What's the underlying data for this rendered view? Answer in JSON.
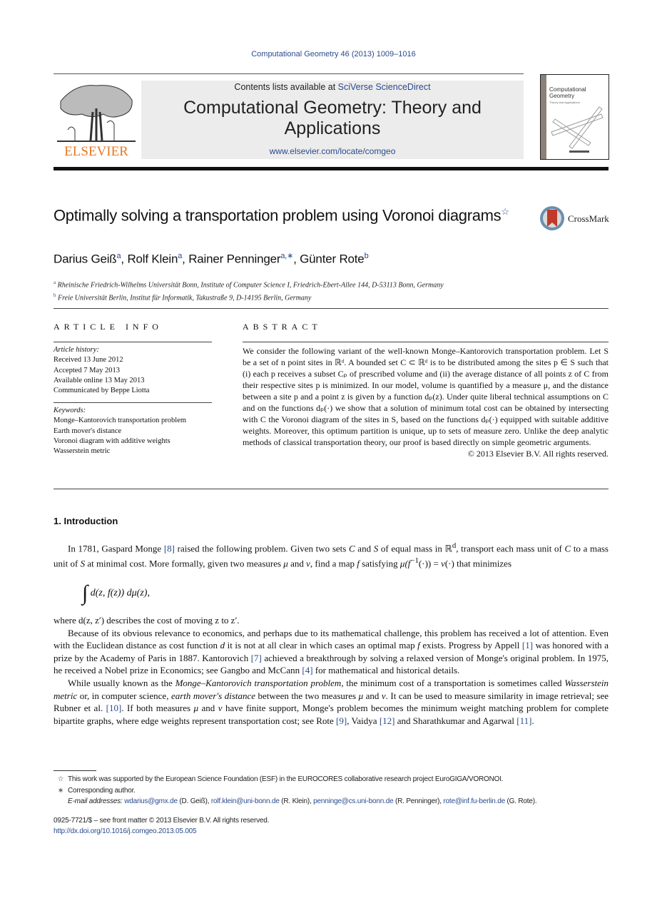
{
  "header": {
    "journal_ref": "Computational Geometry 46 (2013) 1009–1016",
    "publisher_logo_text": "ELSEVIER",
    "contents_prefix": "Contents lists available at ",
    "contents_link": "SciVerse ScienceDirect",
    "journal_title": "Computational Geometry: Theory and Applications",
    "journal_url": "www.elsevier.com/locate/comgeo",
    "cover_title": "Computational Geometry",
    "cover_subtitle": "Theory and Applications"
  },
  "article": {
    "title": "Optimally solving a transportation problem using Voronoi diagrams",
    "title_note_mark": "☆",
    "crossmark_label": "CrossMark",
    "authors": [
      {
        "name": "Darius Geiß",
        "sup": "a"
      },
      {
        "name": "Rolf Klein",
        "sup": "a"
      },
      {
        "name": "Rainer Penninger",
        "sup": "a,∗"
      },
      {
        "name": "Günter Rote",
        "sup": "b"
      }
    ],
    "affiliations": [
      {
        "mark": "a",
        "text": "Rheinische Friedrich-Wilhelms Universität Bonn, Institute of Computer Science I, Friedrich-Ebert-Allee 144, D-53113 Bonn, Germany"
      },
      {
        "mark": "b",
        "text": "Freie Universität Berlin, Institut für Informatik, Takustraße 9, D-14195 Berlin, Germany"
      }
    ]
  },
  "article_info": {
    "heading": "ARTICLE INFO",
    "history_label": "Article history:",
    "history": [
      "Received 13 June 2012",
      "Accepted 7 May 2013",
      "Available online 13 May 2013",
      "Communicated by Beppe Liotta"
    ],
    "keywords_label": "Keywords:",
    "keywords": [
      "Monge–Kantorovich transportation problem",
      "Earth mover's distance",
      "Voronoi diagram with additive weights",
      "Wasserstein metric"
    ]
  },
  "abstract": {
    "heading": "ABSTRACT",
    "text": "We consider the following variant of the well-known Monge–Kantorovich transportation problem. Let S be a set of n point sites in ℝᵈ. A bounded set C ⊂ ℝᵈ is to be distributed among the sites p ∈ S such that (i) each p receives a subset Cₚ of prescribed volume and (ii) the average distance of all points z of C from their respective sites p is minimized. In our model, volume is quantified by a measure μ, and the distance between a site p and a point z is given by a function dₚ(z). Under quite liberal technical assumptions on C and on the functions dₚ(·) we show that a solution of minimum total cost can be obtained by intersecting with C the Voronoi diagram of the sites in S, based on the functions dₚ(·) equipped with suitable additive weights. Moreover, this optimum partition is unique, up to sets of measure zero. Unlike the deep analytic methods of classical transportation theory, our proof is based directly on simple geometric arguments.",
    "copyright": "© 2013 Elsevier B.V. All rights reserved."
  },
  "introduction": {
    "heading": "1. Introduction",
    "p1": [
      {
        "t": "In 1781, Gaspard Monge "
      },
      {
        "ref": "[8]"
      },
      {
        "t": " raised the following problem. Given two sets "
      },
      {
        "i": "C"
      },
      {
        "t": " and "
      },
      {
        "i": "S"
      },
      {
        "t": " of equal mass in ℝ"
      },
      {
        "sup": "d"
      },
      {
        "t": ", transport each mass unit of "
      },
      {
        "i": "C"
      },
      {
        "t": " to a mass unit of "
      },
      {
        "i": "S"
      },
      {
        "t": " at minimal cost. More formally, given two measures "
      },
      {
        "i": "μ"
      },
      {
        "t": " and "
      },
      {
        "i": "ν"
      },
      {
        "t": ", find a map "
      },
      {
        "i": "f"
      },
      {
        "t": " satisfying "
      },
      {
        "i": "μ(f"
      },
      {
        "sup": "−1"
      },
      {
        "t": "(·)) = "
      },
      {
        "i": "ν"
      },
      {
        "t": "(·) that minimizes"
      }
    ],
    "equation": "d(z, f(z)) dμ(z),",
    "after_eq": "where d(z, z′) describes the cost of moving z to z′.",
    "p2": [
      {
        "t": "Because of its obvious relevance to economics, and perhaps due to its mathematical challenge, this problem has received a lot of attention. Even with the Euclidean distance as cost function "
      },
      {
        "i": "d"
      },
      {
        "t": " it is not at all clear in which cases an optimal map "
      },
      {
        "i": "f"
      },
      {
        "t": " exists. Progress by Appell "
      },
      {
        "ref": "[1]"
      },
      {
        "t": " was honored with a prize by the Academy of Paris in 1887. Kantorovich "
      },
      {
        "ref": "[7]"
      },
      {
        "t": " achieved a breakthrough by solving a relaxed version of Monge's original problem. In 1975, he received a Nobel prize in Economics; see Gangbo and McCann "
      },
      {
        "ref": "[4]"
      },
      {
        "t": " for mathematical and historical details."
      }
    ],
    "p3": [
      {
        "t": "While usually known as the "
      },
      {
        "i": "Monge–Kantorovich transportation problem"
      },
      {
        "t": ", the minimum cost of a transportation is sometimes called "
      },
      {
        "i": "Wasserstein metric"
      },
      {
        "t": " or, in computer science, "
      },
      {
        "i": "earth mover's distance"
      },
      {
        "t": " between the two measures "
      },
      {
        "i": "μ"
      },
      {
        "t": " and "
      },
      {
        "i": "ν"
      },
      {
        "t": ". It can be used to measure similarity in image retrieval; see Rubner et al. "
      },
      {
        "ref": "[10]"
      },
      {
        "t": ". If both measures "
      },
      {
        "i": "μ"
      },
      {
        "t": " and "
      },
      {
        "i": "ν"
      },
      {
        "t": " have finite support, Monge's problem becomes the minimum weight matching problem for complete bipartite graphs, where edge weights represent transportation cost; see Rote "
      },
      {
        "ref": "[9]"
      },
      {
        "t": ", Vaidya "
      },
      {
        "ref": "[12]"
      },
      {
        "t": " and Sharathkumar and Agarwal "
      },
      {
        "ref": "[11]"
      },
      {
        "t": "."
      }
    ]
  },
  "footnotes": {
    "star_mark": "☆",
    "star_text": "This work was supported by the European Science Foundation (ESF) in the EUROCORES collaborative research project EuroGIGA/VORONOI.",
    "corr_mark": "∗",
    "corr_text": "Corresponding author.",
    "email_label": "E-mail addresses:",
    "emails": [
      {
        "addr": "wdarius@gmx.de",
        "who": " (D. Geiß), "
      },
      {
        "addr": "rolf.klein@uni-bonn.de",
        "who": " (R. Klein), "
      },
      {
        "addr": "penninge@cs.uni-bonn.de",
        "who": " (R. Penninger), "
      },
      {
        "addr": "rote@inf.fu-berlin.de",
        "who": " (G. Rote)."
      }
    ]
  },
  "front_matter": {
    "issn": "0925-7721/$ – see front matter  © 2013 Elsevier B.V. All rights reserved.",
    "doi": "http://dx.doi.org/10.1016/j.comgeo.2013.05.005"
  },
  "colors": {
    "link": "#2a4b8d",
    "elsevier_orange": "#e87722",
    "masthead_bg": "#ececec"
  }
}
